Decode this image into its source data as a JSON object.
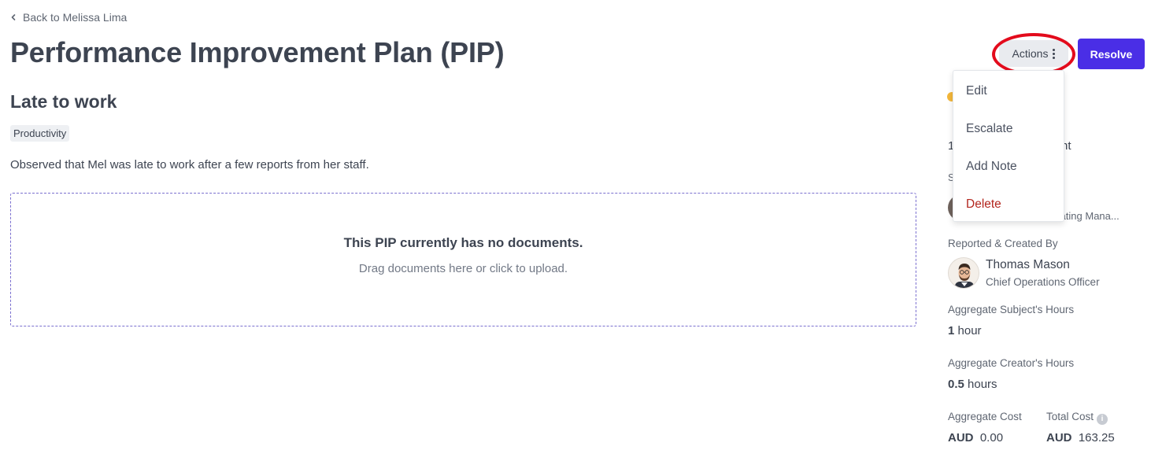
{
  "back_link": {
    "label": "Back to Melissa Lima"
  },
  "page_title": "Performance Improvement Plan (PIP)",
  "issue": {
    "title": "Late to work",
    "tag": "Productivity",
    "description": "Observed that Mel was late to work after a few reports from her staff."
  },
  "dropzone": {
    "title": "This PIP currently has no documents.",
    "subtitle": "Drag documents here or click to upload."
  },
  "header_actions": {
    "actions_label": "Actions",
    "resolve_label": "Resolve"
  },
  "actions_menu": {
    "items": [
      {
        "label": "Edit"
      },
      {
        "label": "Escalate"
      },
      {
        "label": "Add Note"
      },
      {
        "label": "Delete"
      }
    ]
  },
  "sidebar": {
    "partial_texts": [
      "1",
      "nt",
      "S",
      "erating Mana..."
    ],
    "reported_by": {
      "label": "Reported & Created By",
      "name": "Thomas Mason",
      "role": "Chief Operations Officer"
    },
    "subject_hours": {
      "label": "Aggregate Subject's Hours",
      "value": "1",
      "unit": "hour"
    },
    "creator_hours": {
      "label": "Aggregate Creator's Hours",
      "value": "0.5",
      "unit": "hours"
    },
    "aggregate_cost": {
      "label": "Aggregate Cost",
      "currency": "AUD",
      "amount": "0.00"
    },
    "total_cost": {
      "label": "Total Cost",
      "currency": "AUD",
      "amount": "163.25"
    }
  },
  "colors": {
    "primary": "#4a2ee6",
    "status_dot": "#f3b73a",
    "highlight_ring": "#e30b1c",
    "danger_text": "#b3261e"
  },
  "icons": [
    "chevron-left-icon",
    "kebab-icon",
    "info-icon",
    "avatar"
  ]
}
